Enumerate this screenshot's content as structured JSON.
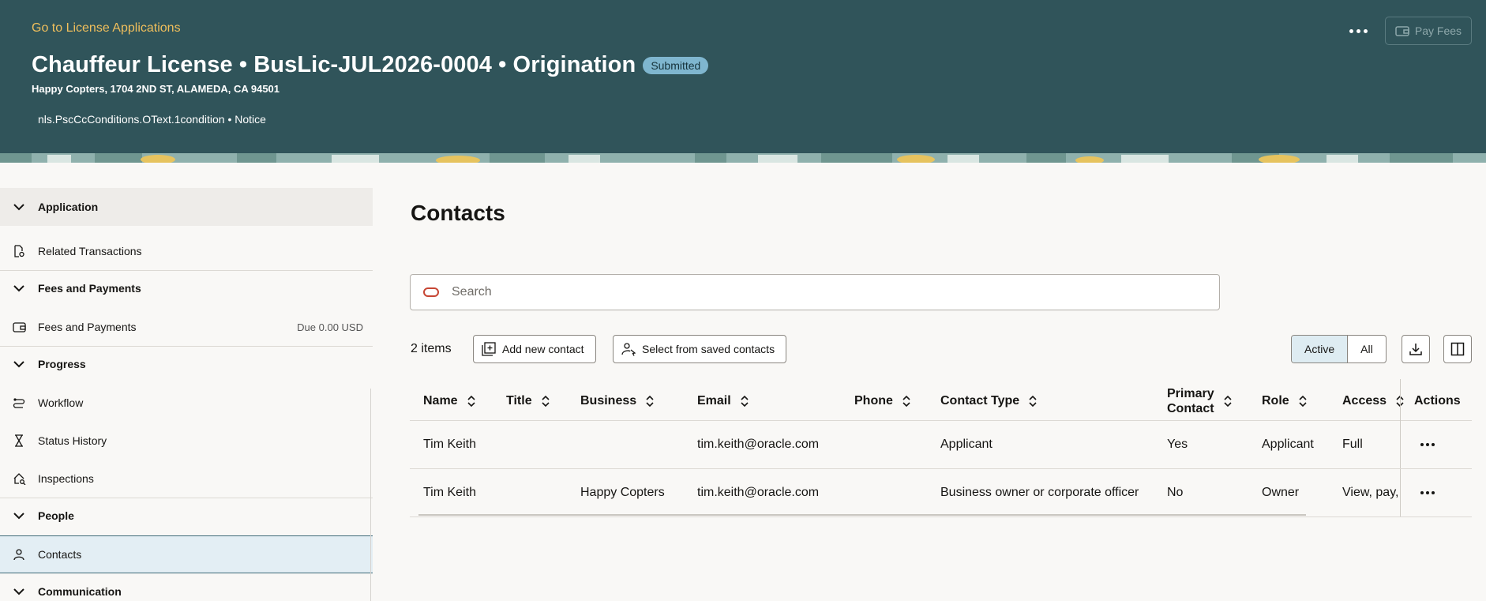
{
  "header": {
    "back_link": "Go to License Applications",
    "title": "Chauffeur License • BusLic-JUL2026-0004 • Origination",
    "status": "Submitted",
    "address": "Happy Copters, 1704 2ND ST, ALAMEDA, CA 94501",
    "condition": "nls.PscCcConditions.OText.1condition • Notice",
    "pay_fees_label": "Pay Fees",
    "colors": {
      "bg": "#30545a",
      "accent": "#f0bf5c",
      "badge": "#7fb6cf"
    }
  },
  "sidebar": {
    "sections": [
      {
        "label": "Application"
      },
      {
        "label": "Fees and Payments"
      },
      {
        "label": "Progress"
      },
      {
        "label": "People"
      },
      {
        "label": "Communication"
      }
    ],
    "items": [
      {
        "label": "Related Transactions",
        "icon": "document-link-icon"
      },
      {
        "label": "Fees and Payments",
        "icon": "wallet-icon",
        "right": "Due 0.00 USD"
      },
      {
        "label": "Workflow",
        "icon": "workflow-icon"
      },
      {
        "label": "Status History",
        "icon": "hourglass-icon"
      },
      {
        "label": "Inspections",
        "icon": "house-search-icon"
      },
      {
        "label": "Contacts",
        "icon": "person-icon",
        "selected": true
      }
    ]
  },
  "main": {
    "title": "Contacts",
    "search_placeholder": "Search",
    "items_count": "2 items",
    "add_contact_label": "Add new contact",
    "select_saved_label": "Select from saved contacts",
    "filter": {
      "active": "Active",
      "all": "All",
      "selected": "Active"
    }
  },
  "table": {
    "columns": [
      "Name",
      "Title",
      "Business",
      "Email",
      "Phone",
      "Contact Type",
      "Primary",
      "Contact",
      "Role",
      "Access",
      "Actions"
    ],
    "rows": [
      {
        "name": "Tim Keith",
        "title": "",
        "business": "",
        "email": "tim.keith@oracle.com",
        "phone": "",
        "contact_type": "Applicant",
        "primary": "Yes",
        "role": "Applicant",
        "access": "Full"
      },
      {
        "name": "Tim Keith",
        "title": "",
        "business": "Happy Copters",
        "email": "tim.keith@oracle.com",
        "phone": "",
        "contact_type": "Business owner or corporate officer",
        "primary": "No",
        "role": "Owner",
        "access": "View, pay,"
      }
    ]
  }
}
